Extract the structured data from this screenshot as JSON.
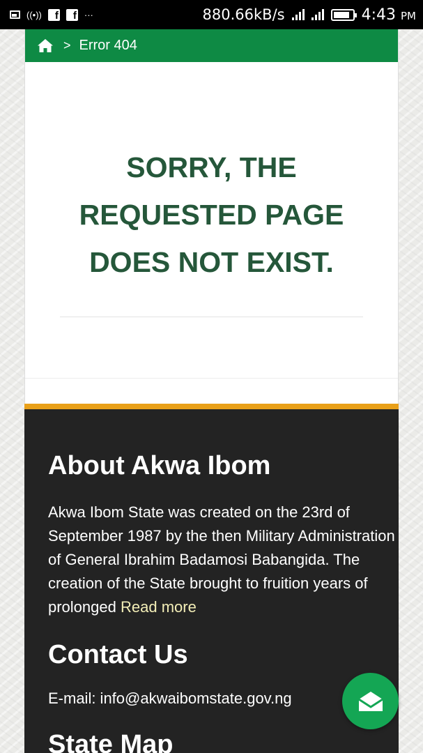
{
  "status_bar": {
    "speed": "880.66kB/s",
    "time": "4:43",
    "time_suffix": "PM",
    "icons": [
      "image-icon",
      "hotspot-icon",
      "facebook-icon",
      "facebook-icon",
      "more-notifications-icon",
      "signal-icon",
      "signal-icon",
      "battery-icon"
    ],
    "more_label": "···"
  },
  "breadcrumb": {
    "home_icon": "home-icon",
    "separator": ">",
    "current": "Error 404"
  },
  "error": {
    "line1": "SORRY, THE",
    "line2": "REQUESTED PAGE",
    "line3": "DOES NOT EXIST."
  },
  "footer": {
    "about_title": "About Akwa Ibom",
    "about_text": "Akwa Ibom State was created on the 23rd of September 1987 by the then Military Administration of General Ibrahim Badamosi Babangida. The creation of the State brought to fruition years of prolonged ",
    "read_more": "Read more",
    "contact_title": "Contact Us",
    "email": "E-mail: info@akwaibomstate.gov.ng",
    "map_title": "State Map"
  },
  "colors": {
    "breadcrumb_bg": "#0e8a44",
    "error_text": "#25573a",
    "footer_bg": "#232323",
    "footer_accent": "#e9a019",
    "read_more": "#f3eeb7",
    "fab_bg": "#14a654"
  },
  "fab": {
    "icon": "envelope-open-icon"
  }
}
